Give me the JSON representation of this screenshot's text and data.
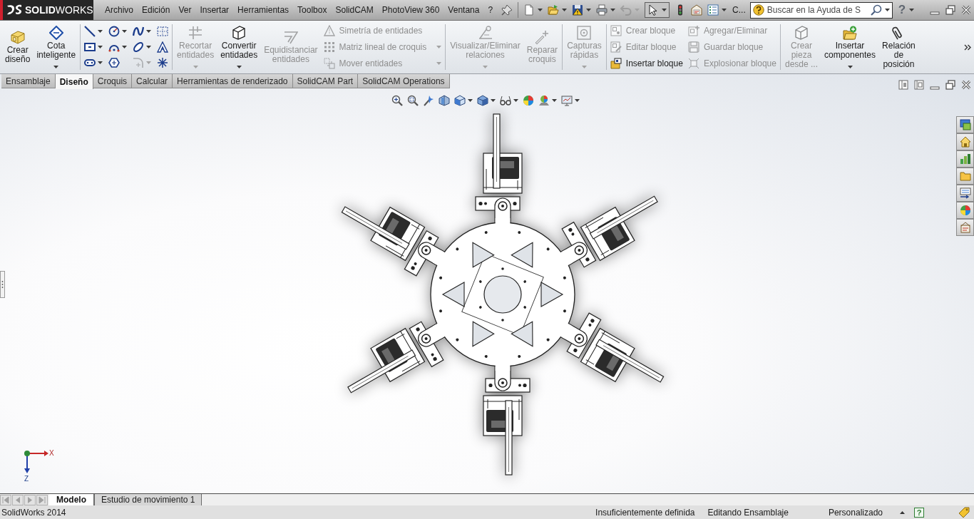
{
  "title_bar": {
    "logo": "**SOLID**WORKS",
    "menu": [
      "Archivo",
      "Edición",
      "Ver",
      "Insertar",
      "Herramientas",
      "Toolbox",
      "SolidCAM",
      "PhotoView 360",
      "Ventana",
      "?"
    ],
    "toolbar": [
      {
        "dropdown": true,
        "disabled": false,
        "selected": false
      },
      {
        "dropdown": true,
        "disabled": false,
        "selected": false
      },
      {
        "dropdown": true,
        "disabled": false,
        "selected": false
      },
      {
        "dropdown": true,
        "disabled": false,
        "selected": false
      },
      {
        "dropdown": true,
        "disabled": true,
        "selected": false
      },
      {
        "dropdown": true,
        "disabled": false,
        "selected": true
      },
      {
        "dropdown": false,
        "disabled": false,
        "selected": false
      },
      {
        "dropdown": false,
        "disabled": false,
        "selected": false
      },
      {
        "dropdown": true,
        "disabled": false,
        "selected": false
      }
    ],
    "command_search": "C...",
    "search": {
      "placeholder": "Buscar en la Ayuda de S"
    },
    "help": "?"
  },
  "ribbon": {
    "sections": [
      {
        "items": [
          {
            "kind": "large",
            "label": "Crear diseño",
            "disabled": false,
            "dropdown": false
          },
          {
            "kind": "large",
            "label": "Cota inteligente",
            "disabled": false,
            "dropdown": true
          }
        ]
      },
      {
        "items": [
          {
            "kind": "grid",
            "tools": [
              {
                "disabled": false,
                "dropdown": true
              },
              {
                "disabled": false,
                "dropdown": true
              },
              {
                "disabled": false,
                "dropdown": true
              },
              {
                "disabled": false,
                "dropdown": false
              },
              {
                "disabled": false,
                "dropdown": true
              },
              {
                "disabled": false,
                "dropdown": true
              },
              {
                "disabled": false,
                "dropdown": true
              },
              {
                "disabled": false,
                "dropdown": false
              },
              {
                "disabled": false,
                "dropdown": true
              },
              {
                "disabled": false,
                "dropdown": false
              },
              {
                "disabled": true,
                "dropdown": true
              },
              {
                "disabled": false,
                "dropdown": false
              }
            ]
          }
        ]
      },
      {
        "items": [
          {
            "kind": "large",
            "label": "Recortar entidades",
            "disabled": true,
            "dropdown": true
          },
          {
            "kind": "large",
            "label": "Convertir entidades",
            "disabled": false,
            "dropdown": true
          },
          {
            "kind": "large",
            "label": "Equidistanciar entidades",
            "disabled": true,
            "dropdown": false
          },
          {
            "kind": "stack",
            "rows": [
              {
                "label": "Simetría de entidades",
                "disabled": true,
                "dropdown": false
              },
              {
                "label": "Matriz lineal de croquis",
                "disabled": true,
                "dropdown": true
              },
              {
                "label": "Mover entidades",
                "disabled": true,
                "dropdown": true
              }
            ]
          }
        ]
      },
      {
        "items": [
          {
            "kind": "large",
            "label": "Visualizar/Eliminar relaciones",
            "disabled": true,
            "dropdown": true
          },
          {
            "kind": "large",
            "label": "Reparar croquis",
            "disabled": true,
            "dropdown": false
          }
        ]
      },
      {
        "items": [
          {
            "kind": "large",
            "label": "Capturas rápidas",
            "disabled": true,
            "dropdown": true
          }
        ]
      },
      {
        "items": [
          {
            "kind": "stack",
            "rows": [
              {
                "label": "Crear bloque",
                "disabled": true,
                "dropdown": false
              },
              {
                "label": "Editar bloque",
                "disabled": true,
                "dropdown": false
              },
              {
                "label": "Insertar bloque",
                "disabled": false,
                "dropdown": false
              }
            ]
          },
          {
            "kind": "stack",
            "rows": [
              {
                "label": "Agregar/Eliminar",
                "disabled": true,
                "dropdown": false
              },
              {
                "label": "Guardar bloque",
                "disabled": true,
                "dropdown": false
              },
              {
                "label": "Explosionar bloque",
                "disabled": true,
                "dropdown": false
              }
            ]
          }
        ]
      },
      {
        "items": [
          {
            "kind": "large",
            "label": "Crear pieza desde ...",
            "disabled": true,
            "dropdown": false
          },
          {
            "kind": "large",
            "label": "Insertar componentes",
            "disabled": false,
            "dropdown": true
          },
          {
            "kind": "large",
            "label": "Relación de posición",
            "disabled": false,
            "dropdown": false
          }
        ]
      }
    ],
    "tabs": [
      {
        "label": "Ensamblaje",
        "selected": false
      },
      {
        "label": "Diseño",
        "selected": true
      },
      {
        "label": "Croquis",
        "selected": false
      },
      {
        "label": "Calcular",
        "selected": false
      },
      {
        "label": "Herramientas de renderizado",
        "selected": false
      },
      {
        "label": "SolidCAM Part",
        "selected": false
      },
      {
        "label": "SolidCAM Operations",
        "selected": false
      }
    ]
  },
  "viewport": {
    "toolbar": [
      {
        "dropdown": false
      },
      {
        "dropdown": false
      },
      {
        "dropdown": false
      },
      {
        "dropdown": false
      },
      {
        "dropdown": true
      },
      {
        "dropdown": true
      },
      {
        "dropdown": true
      },
      {
        "dropdown": false
      },
      {
        "dropdown": true
      },
      {
        "dropdown": true
      }
    ],
    "triad": {
      "x_label": "X",
      "z_label": "Z"
    }
  },
  "bottom_tabs": [
    {
      "label": "Modelo",
      "selected": true
    },
    {
      "label": "Estudio de movimiento 1",
      "selected": false
    }
  ],
  "status_bar": {
    "app": "SolidWorks 2014",
    "fields": [
      "Insuficientemente definida",
      "Editando Ensamblaje",
      "Personalizado"
    ],
    "help": "?"
  }
}
